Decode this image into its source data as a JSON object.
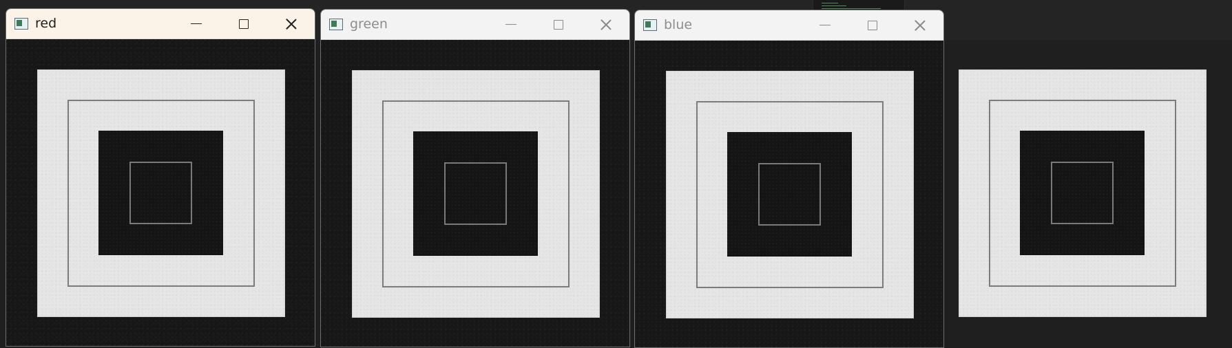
{
  "windows": [
    {
      "title": "red"
    },
    {
      "title": "green"
    },
    {
      "title": "blue"
    }
  ]
}
